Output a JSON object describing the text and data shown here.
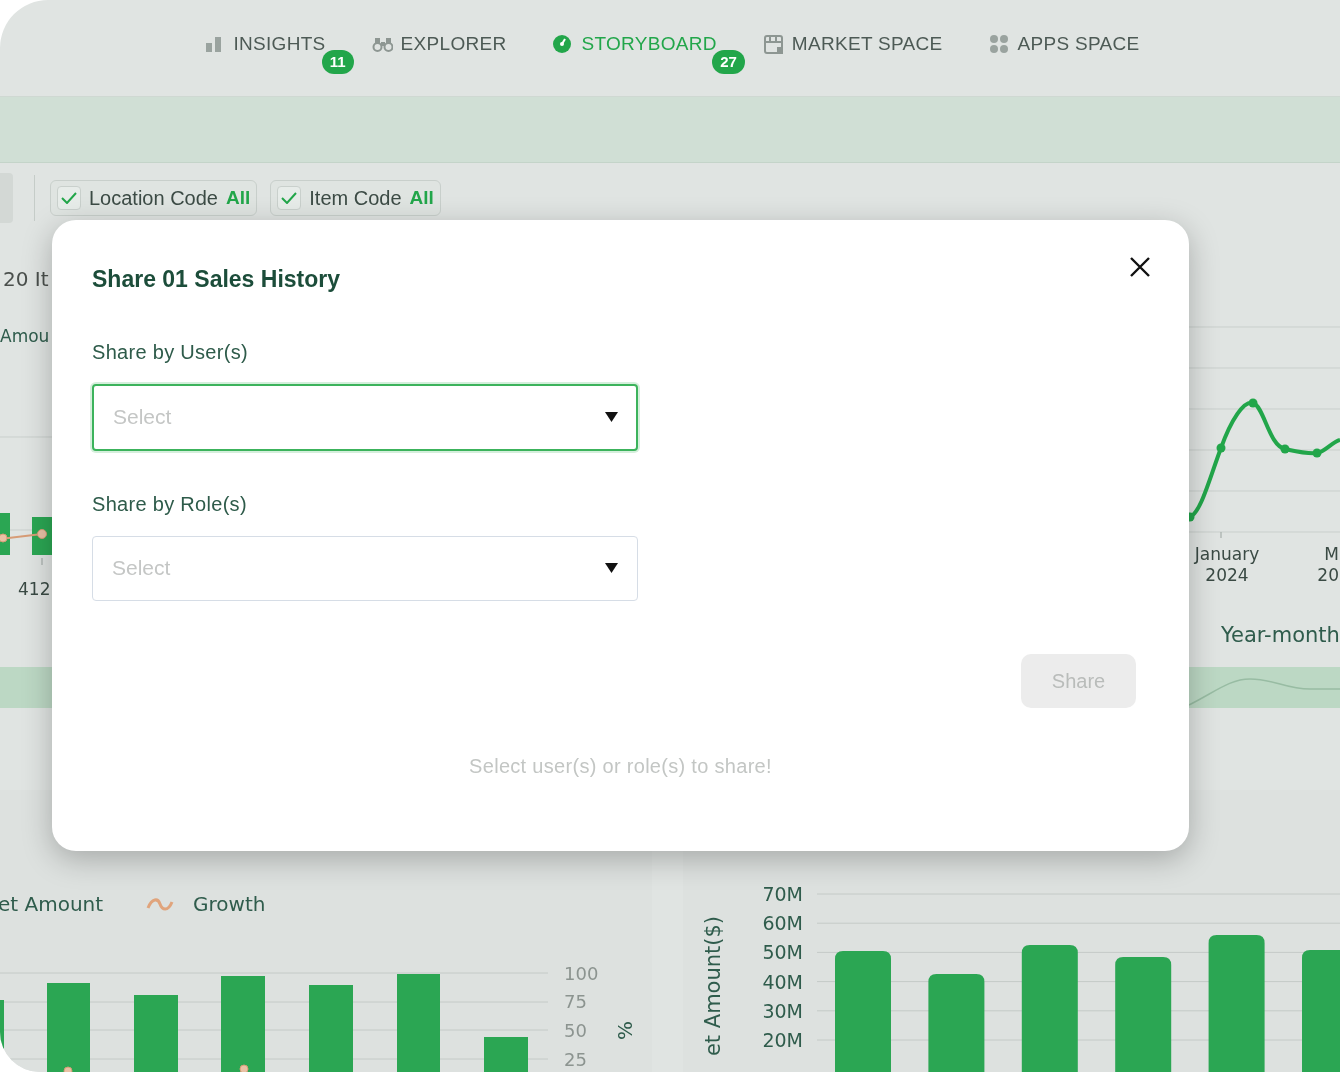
{
  "nav": {
    "tabs": [
      {
        "label": "INSIGHTS",
        "selected": false,
        "badge": "11"
      },
      {
        "label": "EXPLORER",
        "selected": false
      },
      {
        "label": "STORYBOARD",
        "selected": true,
        "badge": "27"
      },
      {
        "label": "MARKET SPACE",
        "selected": false
      },
      {
        "label": "APPS SPACE",
        "selected": false
      }
    ]
  },
  "filters": [
    {
      "label": "Location Code",
      "value": "All",
      "checked": true
    },
    {
      "label": "Item Code",
      "value": "All",
      "checked": true
    }
  ],
  "left_panel": {
    "subtitle": "20 It",
    "axis_title": "Amou",
    "x_label": "412"
  },
  "right_panel": {
    "x_labels": [
      {
        "month": "January",
        "year": "2024"
      },
      {
        "month": "M",
        "year": "20"
      }
    ],
    "axis_title": "Year-month"
  },
  "growth_chart": {
    "legend": [
      "et Amount",
      "Growth"
    ],
    "right_ticks": [
      "100",
      "75",
      "50",
      "25"
    ],
    "right_axis_title": "%"
  },
  "range_slider": {
    "level": 1
  },
  "sales_chart": {
    "chart_data": {
      "type": "bar",
      "grid": true,
      "ylabel": "et Amount($)",
      "ylim": [
        20,
        70
      ],
      "yticks": [
        {
          "value": 20,
          "label": "20M"
        },
        {
          "value": 30,
          "label": "30M"
        },
        {
          "value": 40,
          "label": "40M"
        },
        {
          "value": 50,
          "label": "50M"
        },
        {
          "value": 60,
          "label": "60M"
        },
        {
          "value": 70,
          "label": "70M"
        }
      ],
      "values": [
        50.5,
        42.6,
        52.5,
        48.4,
        56,
        50.8
      ]
    }
  },
  "modal": {
    "title": "Share 01 Sales History",
    "fields": [
      {
        "label": "Share by User(s)",
        "placeholder": "Select",
        "focused": true
      },
      {
        "label": "Share by Role(s)",
        "placeholder": "Select",
        "focused": false
      }
    ],
    "share_button": {
      "label": "Share",
      "disabled": true
    },
    "hint": "Select user(s) or role(s) to share!"
  }
}
